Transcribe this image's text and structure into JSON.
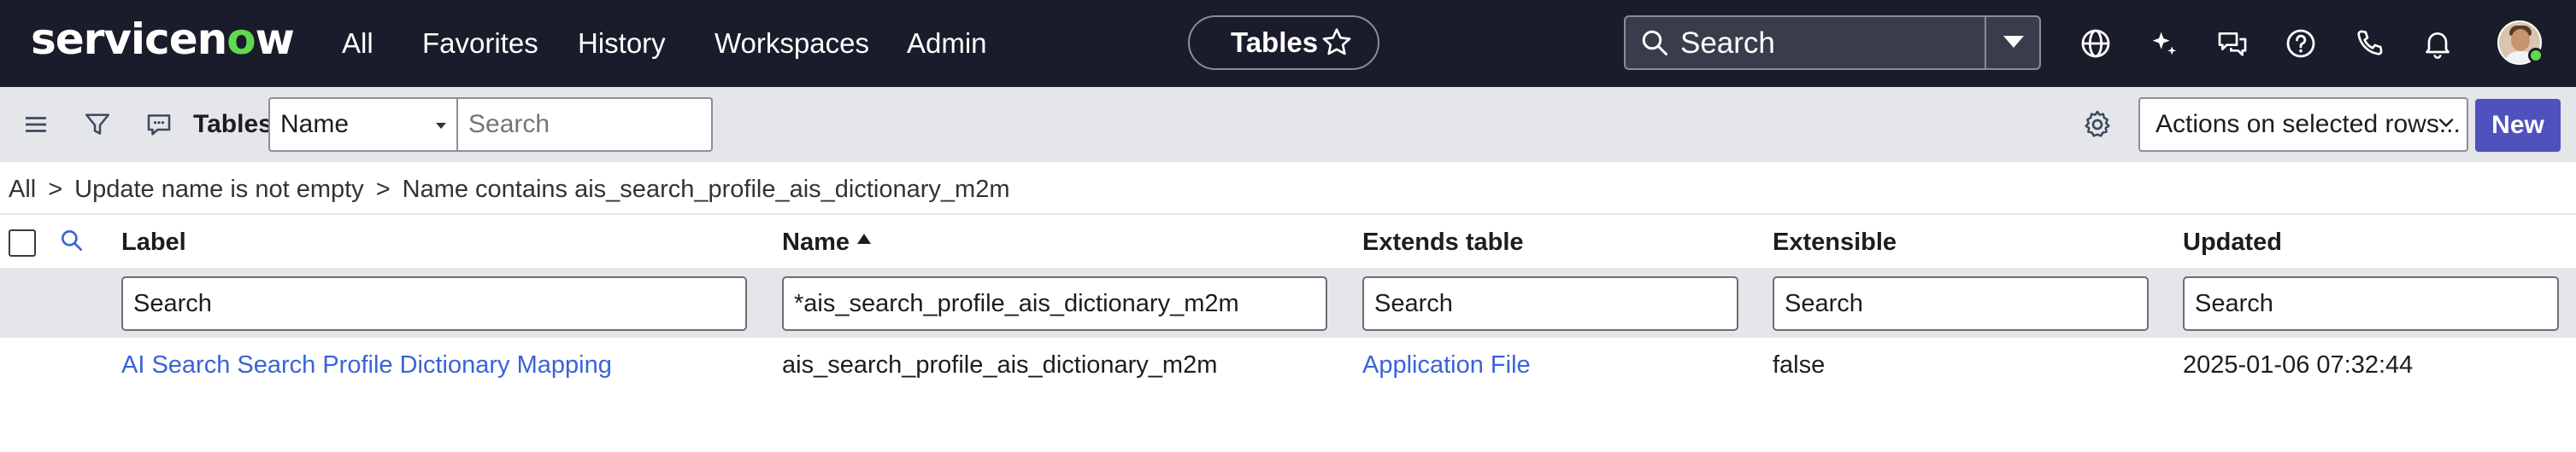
{
  "header": {
    "logo": {
      "pre": "servicen",
      "o": "o",
      "post": "w"
    },
    "nav": [
      "All",
      "Favorites",
      "History",
      "Workspaces",
      "Admin"
    ],
    "context_pill": "Tables",
    "search_placeholder": "Search",
    "icons": [
      "globe-icon",
      "sparkle-icon",
      "chat-icon",
      "help-icon",
      "phone-icon",
      "bell-icon",
      "avatar"
    ]
  },
  "toolbar": {
    "title": "Tables",
    "field_select": "Name",
    "search_placeholder": "Search",
    "actions_select": "Actions on selected rows...",
    "new_label": "New"
  },
  "breadcrumb": [
    "All",
    "Update name is not empty",
    "Name contains ais_search_profile_ais_dictionary_m2m"
  ],
  "breadcrumb_separator": ">",
  "table": {
    "columns": [
      "Label",
      "Name",
      "Extends table",
      "Extensible",
      "Updated"
    ],
    "sort": {
      "column": "Name",
      "direction": "ascending"
    },
    "filters": [
      "Search",
      "*ais_search_profile_ais_dictionary_m2m",
      "Search",
      "Search",
      "Search"
    ],
    "rows": [
      {
        "label": "AI Search Search Profile Dictionary Mapping",
        "name": "ais_search_profile_ais_dictionary_m2m",
        "extends_table": "Application File",
        "extensible": "false",
        "updated": "2025-01-06 07:32:44"
      }
    ]
  },
  "colors": {
    "header_bg": "#1a1c2b",
    "toolbar_bg": "#e4e6ea",
    "brand_green": "#62d84e",
    "primary_button": "#4f52bd",
    "link": "#3a63d8"
  }
}
